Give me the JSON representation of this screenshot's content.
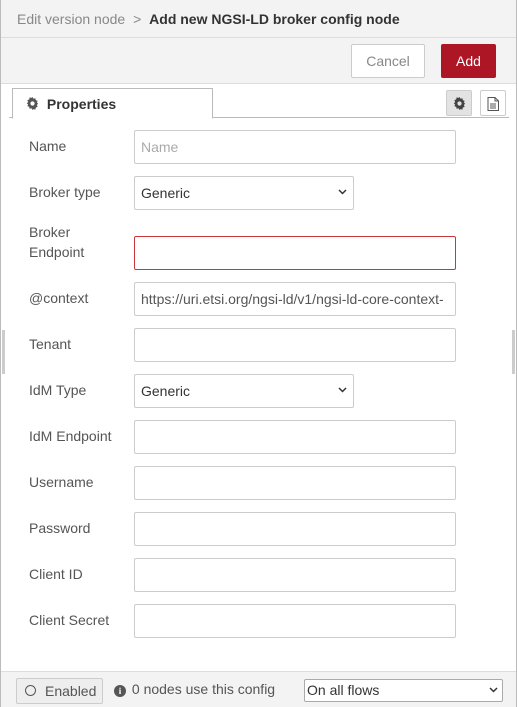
{
  "header": {
    "crumb": "Edit version node",
    "separator": ">",
    "title": "Add new NGSI-LD broker config node"
  },
  "toolbar": {
    "cancel_label": "Cancel",
    "add_label": "Add"
  },
  "tabs": {
    "properties_label": "Properties",
    "settings_icon": "gear-icon",
    "description_icon": "file-icon"
  },
  "form": {
    "name": {
      "label": "Name",
      "value": "",
      "placeholder": "Name"
    },
    "broker_type": {
      "label": "Broker type",
      "value": "Generic"
    },
    "broker_endpoint": {
      "label_line1": "Broker",
      "label_line2": "Endpoint",
      "value": ""
    },
    "context": {
      "label": "@context",
      "value": "https://uri.etsi.org/ngsi-ld/v1/ngsi-ld-core-context-"
    },
    "tenant": {
      "label": "Tenant",
      "value": ""
    },
    "idm_type": {
      "label": "IdM Type",
      "value": "Generic"
    },
    "idm_endpoint": {
      "label": "IdM Endpoint",
      "value": ""
    },
    "username": {
      "label": "Username",
      "value": ""
    },
    "password": {
      "label": "Password",
      "value": ""
    },
    "client_id": {
      "label": "Client ID",
      "value": ""
    },
    "client_secret": {
      "label": "Client Secret",
      "value": ""
    }
  },
  "footer": {
    "enabled_label": "Enabled",
    "usage_text": "0 nodes use this config",
    "scope_value": "On all flows"
  },
  "colors": {
    "accent": "#ad1625",
    "error_border": "#c9373a"
  }
}
